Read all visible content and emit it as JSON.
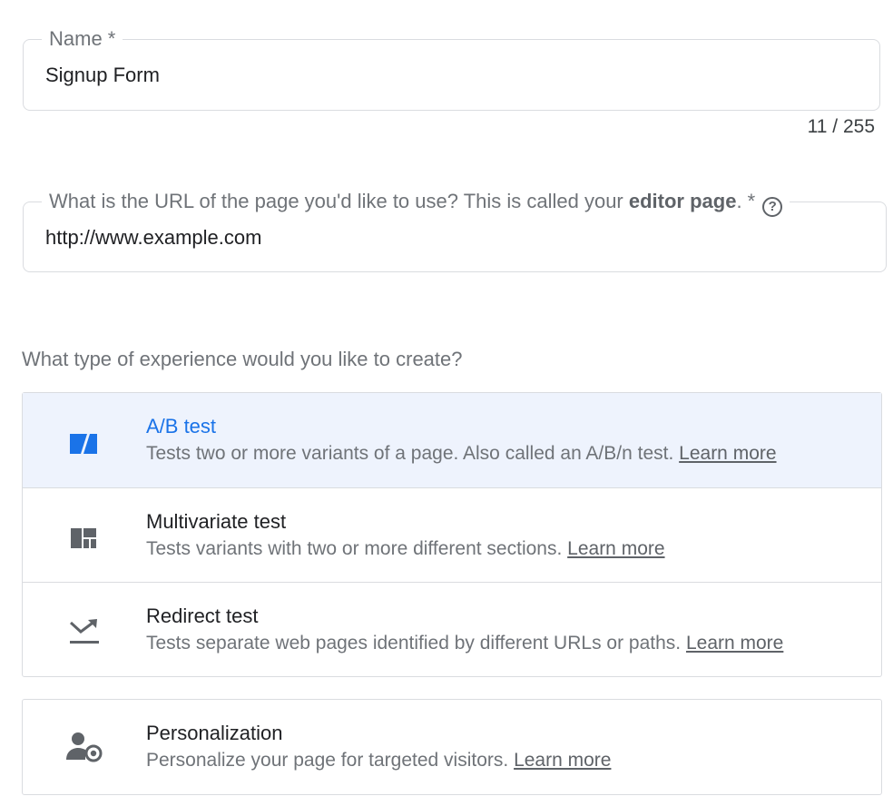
{
  "name_field": {
    "label": "Name *",
    "value": "Signup Form",
    "counter": "11 / 255"
  },
  "url_field": {
    "label_before": "What is the URL of the page you'd like to use? This is called your ",
    "label_bold": "editor page",
    "label_after": ". *",
    "help_glyph": "?",
    "value": "http://www.example.com"
  },
  "experience": {
    "question": "What type of experience would you like to create?",
    "options": [
      {
        "title": "A/B test",
        "description": "Tests two or more variants of a page. Also called an A/B/n test.",
        "link": "Learn more",
        "icon": "ab-test-icon",
        "selected": true
      },
      {
        "title": "Multivariate test",
        "description": "Tests variants with two or more different sections.",
        "link": "Learn more",
        "icon": "multivariate-icon",
        "selected": false
      },
      {
        "title": "Redirect test",
        "description": "Tests separate web pages identified by different URLs or paths.",
        "link": "Learn more",
        "icon": "redirect-icon",
        "selected": false
      }
    ],
    "personalization": {
      "title": "Personalization",
      "description": "Personalize your page for targeted visitors.",
      "link": "Learn more",
      "icon": "person-target-icon"
    }
  },
  "colors": {
    "accent": "#1a73e8",
    "selected_bg": "#eef3fd",
    "border": "#dadce0",
    "icon_gray": "#5f6368"
  }
}
